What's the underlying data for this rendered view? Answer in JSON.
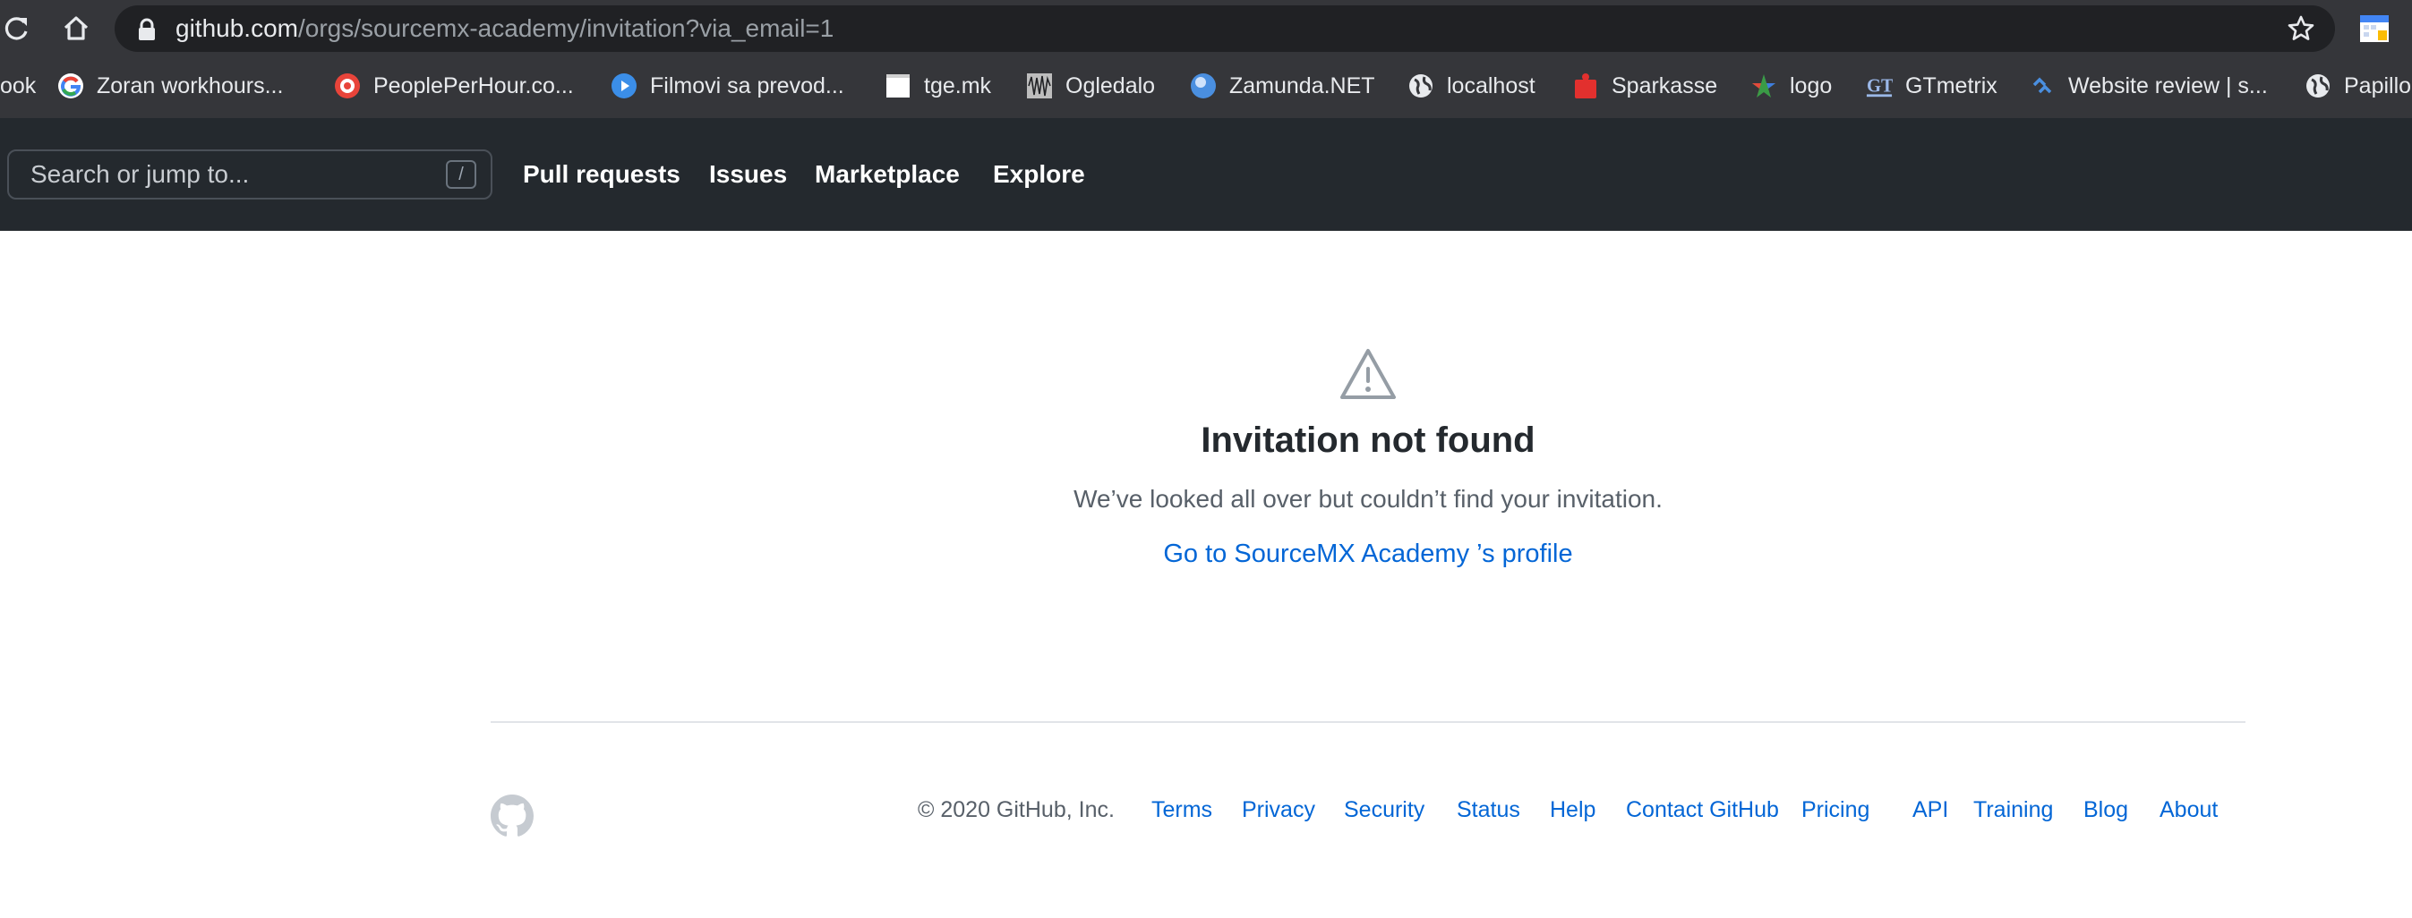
{
  "browser": {
    "url_host": "github.com",
    "url_path": "/orgs/sourcemx-academy/invitation?via_email=1",
    "bookmarks": [
      {
        "label": "ook",
        "icon": "none"
      },
      {
        "label": "Zoran workhours...",
        "icon": "google-icon"
      },
      {
        "label": "PeoplePerHour.co...",
        "icon": "peopleperhour-icon"
      },
      {
        "label": "Filmovi sa prevod...",
        "icon": "play-icon"
      },
      {
        "label": "tge.mk",
        "icon": "page-icon"
      },
      {
        "label": "Ogledalo",
        "icon": "ogledalo-icon"
      },
      {
        "label": "Zamunda.NET",
        "icon": "zamunda-icon"
      },
      {
        "label": "localhost",
        "icon": "globe-icon"
      },
      {
        "label": "Sparkasse",
        "icon": "sparkasse-icon"
      },
      {
        "label": "logo",
        "icon": "logo-star-icon"
      },
      {
        "label": "GTmetrix",
        "icon": "gtmetrix-icon"
      },
      {
        "label": "Website review | s...",
        "icon": "website-review-icon"
      },
      {
        "label": "Papillo",
        "icon": "globe-icon"
      }
    ]
  },
  "header": {
    "search_placeholder": "Search or jump to...",
    "search_shortcut": "/",
    "nav": [
      "Pull requests",
      "Issues",
      "Marketplace",
      "Explore"
    ]
  },
  "main": {
    "title": "Invitation not found",
    "message": "We’ve looked all over but couldn’t find your invitation.",
    "profile_link": "Go to SourceMX Academy ’s profile"
  },
  "footer": {
    "copyright": "© 2020 GitHub, Inc.",
    "links": [
      "Terms",
      "Privacy",
      "Security",
      "Status",
      "Help",
      "Contact GitHub",
      "Pricing",
      "API",
      "Training",
      "Blog",
      "About"
    ]
  },
  "colors": {
    "header_bg": "#24292e",
    "link": "#0366d6",
    "text_primary": "#24292e",
    "text_secondary": "#586069"
  }
}
